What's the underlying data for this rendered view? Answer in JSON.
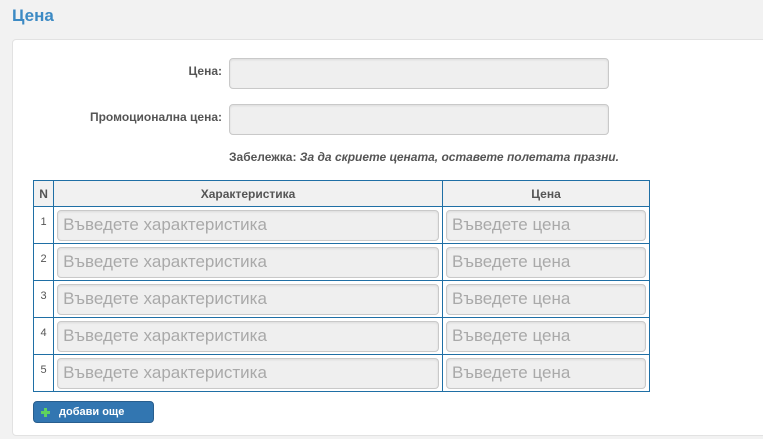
{
  "section": {
    "title": "Цена"
  },
  "form": {
    "price_label": "Цена:",
    "price_value": "",
    "promo_label": "Промоционална цена:",
    "promo_value": "",
    "note_label": "Забележка:",
    "note_text": "За да скриете ценaта, оставете полетата празни."
  },
  "table": {
    "headers": {
      "num": "N",
      "feature": "Характеристика",
      "price": "Цена"
    },
    "rows": [
      {
        "num": "1",
        "feature_placeholder": "Въведете характеристика",
        "price_placeholder": "Въведете цена"
      },
      {
        "num": "2",
        "feature_placeholder": "Въведете характеристика",
        "price_placeholder": "Въведете цена"
      },
      {
        "num": "3",
        "feature_placeholder": "Въведете характеристика",
        "price_placeholder": "Въведете цена"
      },
      {
        "num": "4",
        "feature_placeholder": "Въведете характеристика",
        "price_placeholder": "Въведете цена"
      },
      {
        "num": "5",
        "feature_placeholder": "Въведете характеристика",
        "price_placeholder": "Въведете цена"
      }
    ]
  },
  "actions": {
    "add_more_label": "добави още"
  },
  "colors": {
    "accent": "#3c8ac4",
    "button": "#3276b1",
    "table_border": "#1f6fa5",
    "plus": "#5fd35f"
  }
}
